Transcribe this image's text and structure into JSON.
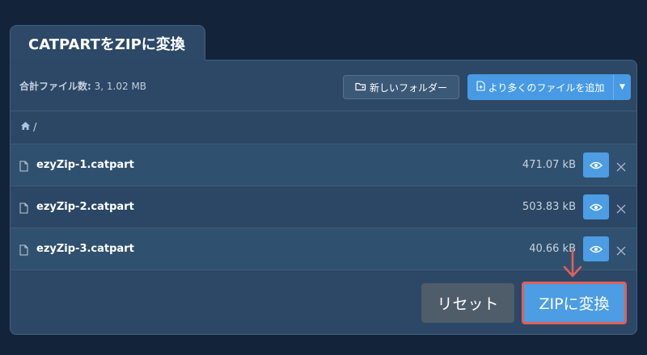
{
  "tab": {
    "title": "CATPARTをZIPに変換"
  },
  "toolbar": {
    "file_count_label": "合計ファイル数:",
    "file_count_value": "3, 1.02 MB",
    "new_folder_label": "新しいフォルダー",
    "add_files_label": "より多くのファイルを追加"
  },
  "path": {
    "root": "/"
  },
  "files": [
    {
      "name": "ezyZip-1.catpart",
      "size": "471.07 kB"
    },
    {
      "name": "ezyZip-2.catpart",
      "size": "503.83 kB"
    },
    {
      "name": "ezyZip-3.catpart",
      "size": "40.66 kB"
    }
  ],
  "footer": {
    "reset_label": "リセット",
    "convert_label": "ZIPに変換"
  },
  "icons": [
    "file-icon",
    "eye-icon",
    "close-icon",
    "home-icon",
    "folder-plus-icon",
    "file-plus-icon",
    "caret-down-icon",
    "arrow-down-icon"
  ],
  "colors": {
    "accent": "#4c9de3",
    "highlight": "#e0605a",
    "panel": "#2c4866",
    "background": "#13233a"
  }
}
